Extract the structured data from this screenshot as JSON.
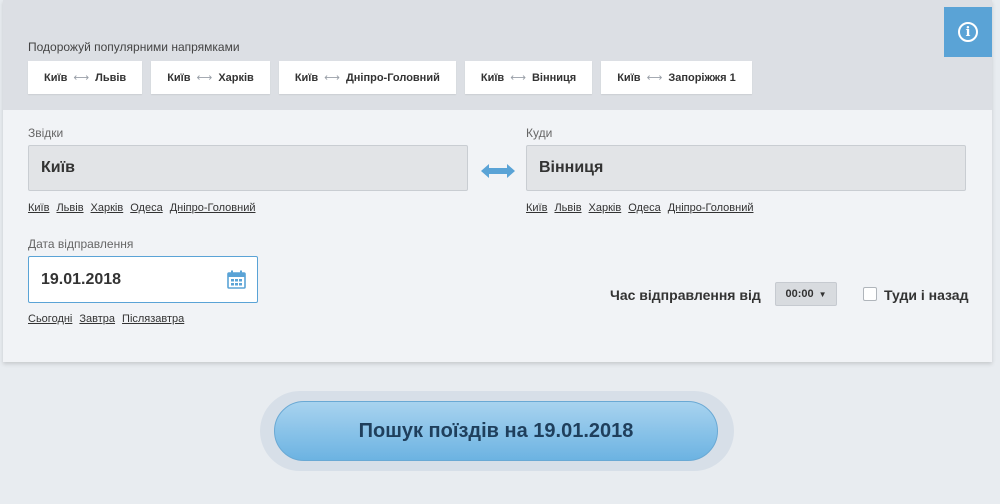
{
  "popular": {
    "title": "Подорожуй популярними напрямками",
    "routes": [
      {
        "from": "Київ",
        "to": "Львів"
      },
      {
        "from": "Київ",
        "to": "Харків"
      },
      {
        "from": "Київ",
        "to": "Дніпро-Головний"
      },
      {
        "from": "Київ",
        "to": "Вінниця"
      },
      {
        "from": "Київ",
        "to": "Запоріжжя 1"
      }
    ],
    "arrow_glyph": "⟷"
  },
  "info_icon": "info-icon",
  "from": {
    "label": "Звідки",
    "value": "Київ",
    "quick": [
      "Київ",
      "Львів",
      "Харків",
      "Одеса",
      "Дніпро-Головний"
    ]
  },
  "to": {
    "label": "Куди",
    "value": "Вінниця",
    "quick": [
      "Київ",
      "Львів",
      "Харків",
      "Одеса",
      "Дніпро-Головний"
    ]
  },
  "date": {
    "label": "Дата відправлення",
    "value": "19.01.2018",
    "quick": [
      "Сьогодні",
      "Завтра",
      "Післязавтра"
    ]
  },
  "time": {
    "label": "Час відправлення від",
    "value": "00:00",
    "caret": "▼"
  },
  "round_trip": {
    "label": "Туди і назад",
    "checked": false
  },
  "search_button": {
    "label": "Пошук поїздів на 19.01.2018"
  },
  "colors": {
    "accent": "#5aa3d6",
    "button_text": "#1f3f5c"
  }
}
